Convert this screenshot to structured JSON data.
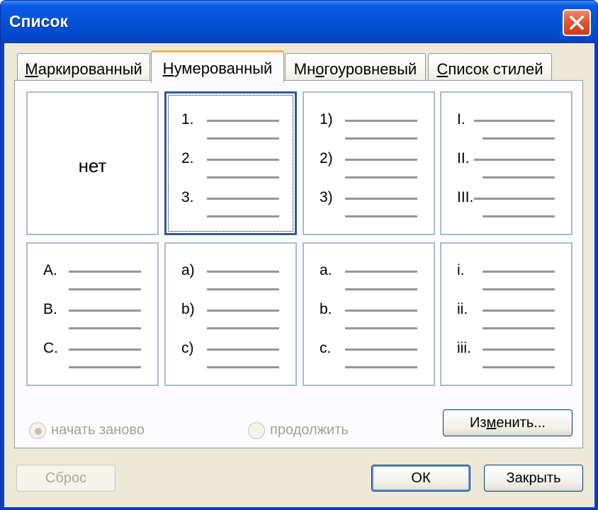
{
  "window": {
    "title": "Список"
  },
  "tabs": [
    {
      "label": "Маркированный",
      "mnemonic_index": 0,
      "active": false
    },
    {
      "label": "Нумерованный",
      "mnemonic_index": 0,
      "active": true
    },
    {
      "label": "Многоуровневый",
      "mnemonic_index": 2,
      "active": false
    },
    {
      "label": "Список стилей",
      "mnemonic_index": 0,
      "active": false
    }
  ],
  "gallery": {
    "none_label": "нет",
    "styles": [
      {
        "id": "none",
        "labels": []
      },
      {
        "id": "decimal-dot",
        "labels": [
          "1.",
          "2.",
          "3."
        ],
        "selected": true
      },
      {
        "id": "decimal-paren",
        "labels": [
          "1)",
          "2)",
          "3)"
        ]
      },
      {
        "id": "upper-roman",
        "labels": [
          "I.",
          "II.",
          "III."
        ]
      },
      {
        "id": "upper-alpha",
        "labels": [
          "A.",
          "B.",
          "C."
        ]
      },
      {
        "id": "lower-alpha-paren",
        "labels": [
          "a)",
          "b)",
          "c)"
        ]
      },
      {
        "id": "lower-alpha-dot",
        "labels": [
          "a.",
          "b.",
          "c."
        ]
      },
      {
        "id": "lower-roman",
        "labels": [
          "i.",
          "ii.",
          "iii."
        ]
      }
    ]
  },
  "numbering": {
    "restart_label": "начать заново",
    "continue_label": "продолжить",
    "restart_checked": true,
    "enabled": false
  },
  "buttons": {
    "customize": "Изменить...",
    "reset": "Сброс",
    "ok": "ОК",
    "close": "Закрыть"
  },
  "colors": {
    "titlebar": "#0453d8",
    "dialog_bg": "#ece9d8",
    "active_tab_accent": "#f5b343",
    "selection_border": "#2f5a98",
    "close_button": "#df5a32"
  }
}
